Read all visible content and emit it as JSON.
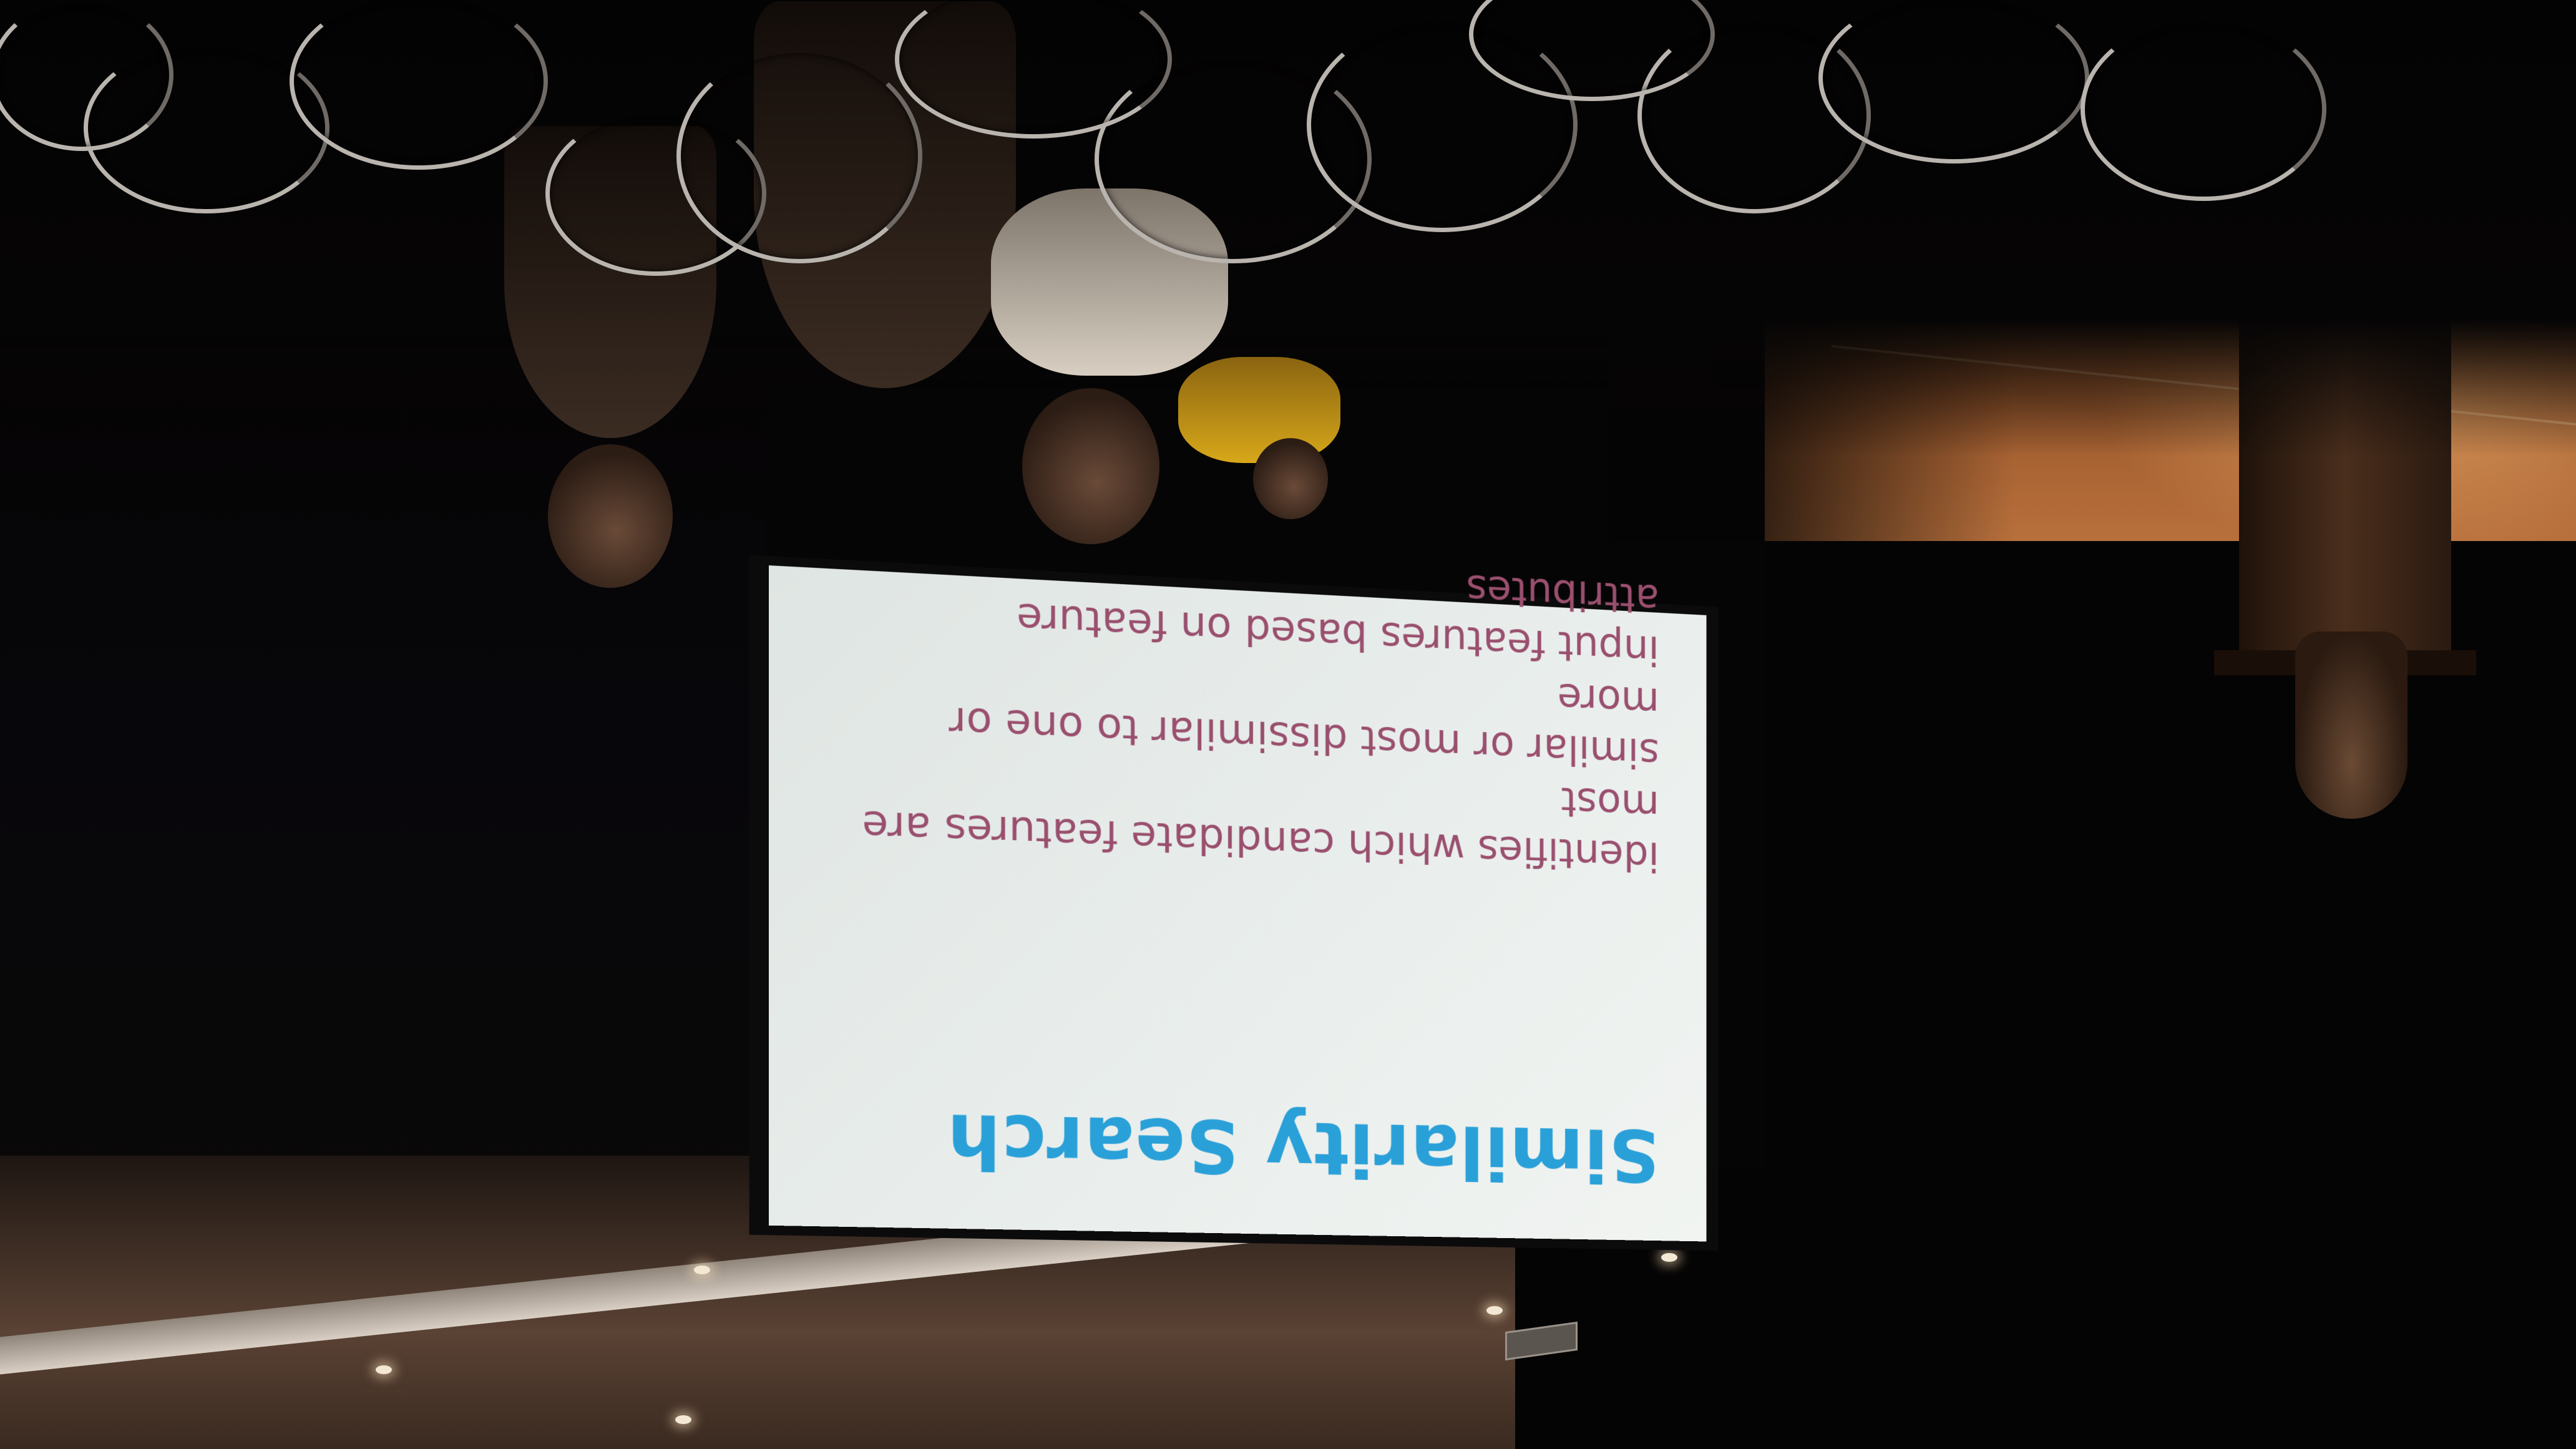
{
  "slide": {
    "title": "Similarity Search",
    "body_lines": [
      "identifies which candidate features are most",
      "similar or most dissimilar to one or more",
      "input features based on feature attributes"
    ]
  },
  "colors": {
    "title": "#2aa0d8",
    "body": "#9a4f6e",
    "screen": "#eef1ef",
    "stage_light": "#b8703c",
    "background": "#050404"
  },
  "orientation": "upside-down"
}
